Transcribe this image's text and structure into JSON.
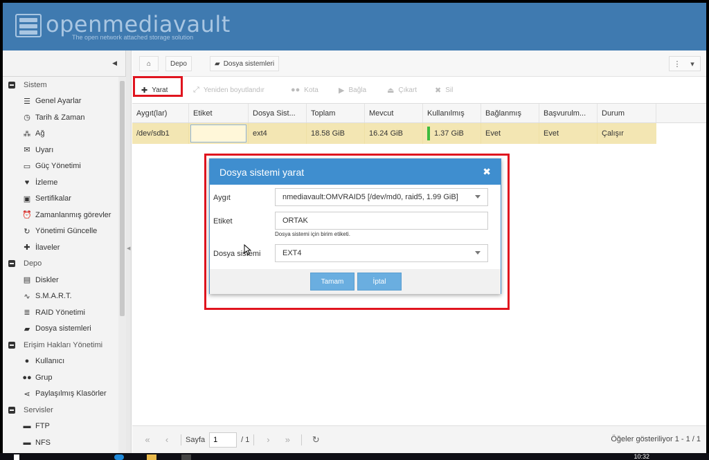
{
  "app": {
    "name": "openmediavault",
    "tagline": "The open network attached storage solution"
  },
  "sidebar": {
    "groups": [
      {
        "label": "Sistem",
        "items": [
          {
            "label": "Genel Ayarlar",
            "icon": "sliders-icon"
          },
          {
            "label": "Tarih & Zaman",
            "icon": "clock-icon"
          },
          {
            "label": "Ağ",
            "icon": "network-icon"
          },
          {
            "label": "Uyarı",
            "icon": "envelope-icon"
          },
          {
            "label": "Güç Yönetimi",
            "icon": "battery-icon"
          },
          {
            "label": "İzleme",
            "icon": "heartbeat-icon"
          },
          {
            "label": "Sertifikalar",
            "icon": "certificate-icon"
          },
          {
            "label": "Zamanlanmış görevler",
            "icon": "alarm-clock-icon"
          },
          {
            "label": "Yönetimi Güncelle",
            "icon": "refresh-icon"
          },
          {
            "label": "İlaveler",
            "icon": "puzzle-icon"
          }
        ]
      },
      {
        "label": "Depo",
        "items": [
          {
            "label": "Diskler",
            "icon": "disk-icon"
          },
          {
            "label": "S.M.A.R.T.",
            "icon": "pulse-icon"
          },
          {
            "label": "RAID Yönetimi",
            "icon": "database-icon"
          },
          {
            "label": "Dosya sistemleri",
            "icon": "folder-icon"
          }
        ]
      },
      {
        "label": "Erişim Hakları Yönetimi",
        "items": [
          {
            "label": "Kullanıcı",
            "icon": "user-icon"
          },
          {
            "label": "Grup",
            "icon": "users-icon"
          },
          {
            "label": "Paylaşılmış Klasörler",
            "icon": "share-icon"
          }
        ]
      },
      {
        "label": "Servisler",
        "items": [
          {
            "label": "FTP",
            "icon": "ftp-icon"
          },
          {
            "label": "NFS",
            "icon": "nfs-icon"
          }
        ]
      }
    ]
  },
  "breadcrumb": {
    "depo": "Depo",
    "fs": "Dosya sistemleri"
  },
  "toolbar": {
    "create": "Yarat",
    "resize": "Yeniden boyutlandır",
    "quota": "Kota",
    "mount": "Bağla",
    "unmount": "Çıkart",
    "delete": "Sil"
  },
  "grid": {
    "columns": [
      "Aygıt(lar)",
      "Etiket",
      "Dosya Sist...",
      "Toplam",
      "Mevcut",
      "Kullanılmış",
      "Bağlanmış",
      "Başvurulm...",
      "Durum"
    ],
    "rows": [
      {
        "device": "/dev/sdb1",
        "label": "",
        "fstype": "ext4",
        "total": "18.58 GiB",
        "available": "16.24 GiB",
        "used": "1.37 GiB",
        "mounted": "Evet",
        "referenced": "Evet",
        "status": "Çalışır"
      }
    ]
  },
  "pager": {
    "page_label": "Sayfa",
    "page_value": "1",
    "page_total": "/ 1",
    "status": "Öğeler gösteriliyor 1 - 1 / 1"
  },
  "dialog": {
    "title": "Dosya sistemi yarat",
    "device_label": "Aygıt",
    "device_value": "nmediavault:OMVRAID5 [/dev/md0, raid5, 1.99 GiB]",
    "label_label": "Etiket",
    "label_value": "ORTAK",
    "label_hint": "Dosya sistemi için birim etiketi.",
    "fs_label": "Dosya sistemi",
    "fs_value": "EXT4",
    "ok": "Tamam",
    "cancel": "İptal"
  },
  "taskbar": {
    "clock": "10:32"
  },
  "colors": {
    "header": "#3f7ab0",
    "dialog_title": "#3f8ecf",
    "selected_row": "#f3e6b3",
    "highlight_box": "#e0141e",
    "button": "#6aaee0"
  }
}
